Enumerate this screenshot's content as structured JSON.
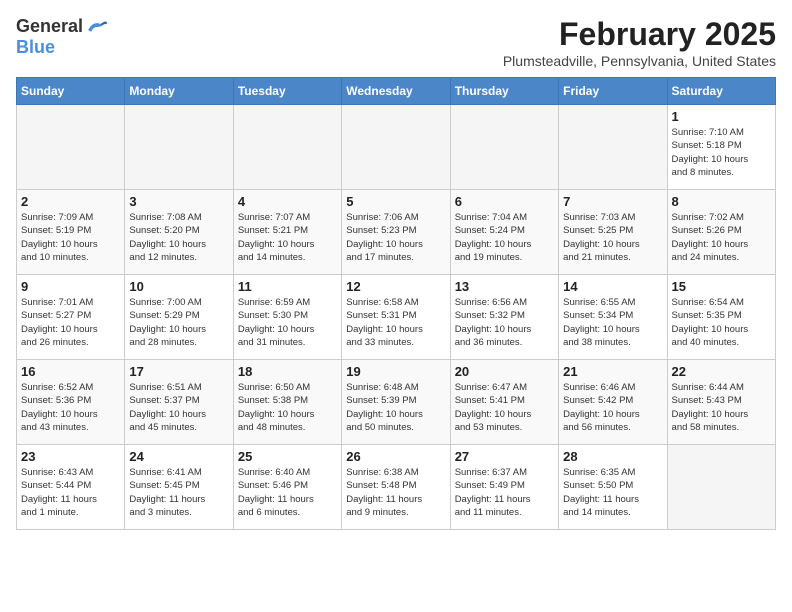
{
  "header": {
    "logo_general": "General",
    "logo_blue": "Blue",
    "title": "February 2025",
    "subtitle": "Plumsteadville, Pennsylvania, United States"
  },
  "days_of_week": [
    "Sunday",
    "Monday",
    "Tuesday",
    "Wednesday",
    "Thursday",
    "Friday",
    "Saturday"
  ],
  "weeks": [
    [
      {
        "day": "",
        "info": ""
      },
      {
        "day": "",
        "info": ""
      },
      {
        "day": "",
        "info": ""
      },
      {
        "day": "",
        "info": ""
      },
      {
        "day": "",
        "info": ""
      },
      {
        "day": "",
        "info": ""
      },
      {
        "day": "1",
        "info": "Sunrise: 7:10 AM\nSunset: 5:18 PM\nDaylight: 10 hours\nand 8 minutes."
      }
    ],
    [
      {
        "day": "2",
        "info": "Sunrise: 7:09 AM\nSunset: 5:19 PM\nDaylight: 10 hours\nand 10 minutes."
      },
      {
        "day": "3",
        "info": "Sunrise: 7:08 AM\nSunset: 5:20 PM\nDaylight: 10 hours\nand 12 minutes."
      },
      {
        "day": "4",
        "info": "Sunrise: 7:07 AM\nSunset: 5:21 PM\nDaylight: 10 hours\nand 14 minutes."
      },
      {
        "day": "5",
        "info": "Sunrise: 7:06 AM\nSunset: 5:23 PM\nDaylight: 10 hours\nand 17 minutes."
      },
      {
        "day": "6",
        "info": "Sunrise: 7:04 AM\nSunset: 5:24 PM\nDaylight: 10 hours\nand 19 minutes."
      },
      {
        "day": "7",
        "info": "Sunrise: 7:03 AM\nSunset: 5:25 PM\nDaylight: 10 hours\nand 21 minutes."
      },
      {
        "day": "8",
        "info": "Sunrise: 7:02 AM\nSunset: 5:26 PM\nDaylight: 10 hours\nand 24 minutes."
      }
    ],
    [
      {
        "day": "9",
        "info": "Sunrise: 7:01 AM\nSunset: 5:27 PM\nDaylight: 10 hours\nand 26 minutes."
      },
      {
        "day": "10",
        "info": "Sunrise: 7:00 AM\nSunset: 5:29 PM\nDaylight: 10 hours\nand 28 minutes."
      },
      {
        "day": "11",
        "info": "Sunrise: 6:59 AM\nSunset: 5:30 PM\nDaylight: 10 hours\nand 31 minutes."
      },
      {
        "day": "12",
        "info": "Sunrise: 6:58 AM\nSunset: 5:31 PM\nDaylight: 10 hours\nand 33 minutes."
      },
      {
        "day": "13",
        "info": "Sunrise: 6:56 AM\nSunset: 5:32 PM\nDaylight: 10 hours\nand 36 minutes."
      },
      {
        "day": "14",
        "info": "Sunrise: 6:55 AM\nSunset: 5:34 PM\nDaylight: 10 hours\nand 38 minutes."
      },
      {
        "day": "15",
        "info": "Sunrise: 6:54 AM\nSunset: 5:35 PM\nDaylight: 10 hours\nand 40 minutes."
      }
    ],
    [
      {
        "day": "16",
        "info": "Sunrise: 6:52 AM\nSunset: 5:36 PM\nDaylight: 10 hours\nand 43 minutes."
      },
      {
        "day": "17",
        "info": "Sunrise: 6:51 AM\nSunset: 5:37 PM\nDaylight: 10 hours\nand 45 minutes."
      },
      {
        "day": "18",
        "info": "Sunrise: 6:50 AM\nSunset: 5:38 PM\nDaylight: 10 hours\nand 48 minutes."
      },
      {
        "day": "19",
        "info": "Sunrise: 6:48 AM\nSunset: 5:39 PM\nDaylight: 10 hours\nand 50 minutes."
      },
      {
        "day": "20",
        "info": "Sunrise: 6:47 AM\nSunset: 5:41 PM\nDaylight: 10 hours\nand 53 minutes."
      },
      {
        "day": "21",
        "info": "Sunrise: 6:46 AM\nSunset: 5:42 PM\nDaylight: 10 hours\nand 56 minutes."
      },
      {
        "day": "22",
        "info": "Sunrise: 6:44 AM\nSunset: 5:43 PM\nDaylight: 10 hours\nand 58 minutes."
      }
    ],
    [
      {
        "day": "23",
        "info": "Sunrise: 6:43 AM\nSunset: 5:44 PM\nDaylight: 11 hours\nand 1 minute."
      },
      {
        "day": "24",
        "info": "Sunrise: 6:41 AM\nSunset: 5:45 PM\nDaylight: 11 hours\nand 3 minutes."
      },
      {
        "day": "25",
        "info": "Sunrise: 6:40 AM\nSunset: 5:46 PM\nDaylight: 11 hours\nand 6 minutes."
      },
      {
        "day": "26",
        "info": "Sunrise: 6:38 AM\nSunset: 5:48 PM\nDaylight: 11 hours\nand 9 minutes."
      },
      {
        "day": "27",
        "info": "Sunrise: 6:37 AM\nSunset: 5:49 PM\nDaylight: 11 hours\nand 11 minutes."
      },
      {
        "day": "28",
        "info": "Sunrise: 6:35 AM\nSunset: 5:50 PM\nDaylight: 11 hours\nand 14 minutes."
      },
      {
        "day": "",
        "info": ""
      }
    ]
  ]
}
